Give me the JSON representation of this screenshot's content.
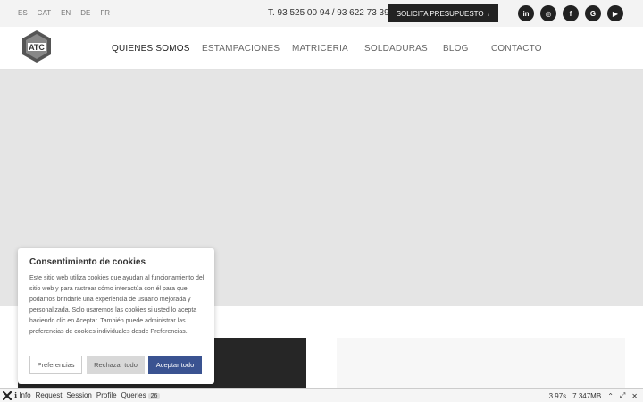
{
  "topbar": {
    "languages": [
      "ES",
      "CAT",
      "EN",
      "DE",
      "FR"
    ],
    "phone": "T. 93 525 00 94 / 93 622 73 39",
    "cta_label": "SOLICITA PRESUPUESTO",
    "socials": [
      {
        "icon": "linkedin-icon",
        "glyph": "in"
      },
      {
        "icon": "instagram-icon",
        "glyph": "◎"
      },
      {
        "icon": "facebook-icon",
        "glyph": "f"
      },
      {
        "icon": "google-icon",
        "glyph": "G"
      },
      {
        "icon": "youtube-icon",
        "glyph": "▶"
      }
    ]
  },
  "header": {
    "logo_text": "ATC",
    "nav": [
      "QUIENES SOMOS",
      "ESTAMPACIONES",
      "MATRICERIA",
      "SOLDADURAS",
      "BLOG",
      "CONTACTO"
    ]
  },
  "cookie": {
    "title": "Consentimiento de cookies",
    "text": "Este sitio web utiliza cookies que ayudan al funcionamiento del sitio web y para rastrear cómo interactúa con él para que podamos brindarle una experiencia de usuario mejorada y personalizada. Solo usaremos las cookies si usted lo acepta haciendo clic en Aceptar. También puede administrar las preferencias de cookies individuales desde Preferencias.",
    "preferences_label": "Preferencias",
    "reject_label": "Rechazar todo",
    "accept_label": "Aceptar todo"
  },
  "debug": {
    "items": [
      "Info",
      "Request",
      "Session",
      "Profile",
      "Queries"
    ],
    "queries_count": "26",
    "time": "3.97s",
    "memory": "7.347MB"
  },
  "colors": {
    "accent": "#3a5391",
    "dark": "#222222",
    "hero_bg": "#e5e5e5"
  }
}
